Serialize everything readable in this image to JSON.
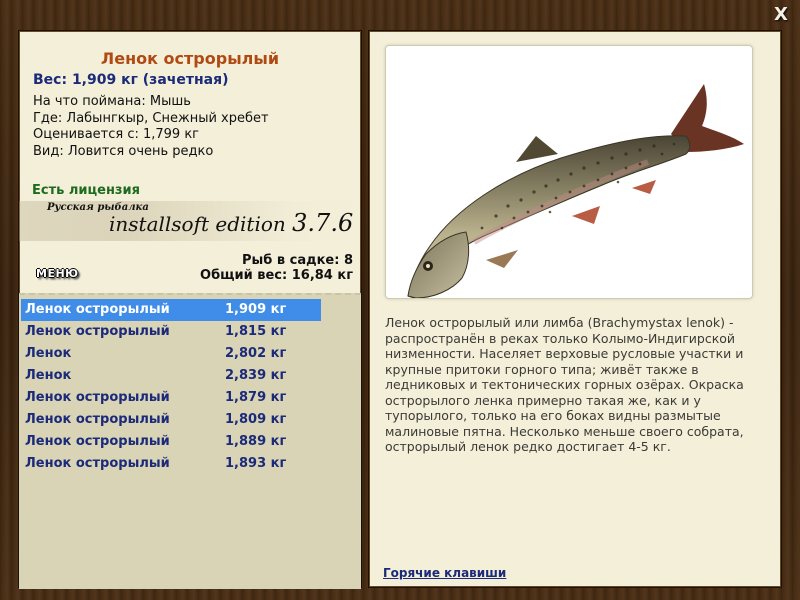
{
  "window": {
    "close_label": "X"
  },
  "fish": {
    "title": "Ленок острорылый",
    "weight_line": "Вес: 1,909 кг (зачетная)",
    "details": [
      "На что поймана: Мышь",
      "Где: Лабынгкыр, Снежный хребет",
      "Оценивается с: 1,799 кг",
      "Вид: Ловится очень редко"
    ],
    "license": "Есть лицензия",
    "image_name": "lenok-trout-photo"
  },
  "edition": {
    "small": "Русская рыбалка",
    "main": "installsoft edition",
    "version": "3.7.6"
  },
  "menu": {
    "label": "МЕНЮ"
  },
  "stats": {
    "count_line": "Рыб в садке: 8",
    "total_line": "Общий вес: 16,84 кг"
  },
  "catch_list": [
    {
      "name": "Ленок острорылый",
      "weight": "1,909 кг",
      "selected": true
    },
    {
      "name": "Ленок острорылый",
      "weight": "1,815 кг",
      "selected": false
    },
    {
      "name": "Ленок",
      "weight": "2,802 кг",
      "selected": false
    },
    {
      "name": "Ленок",
      "weight": "2,839 кг",
      "selected": false
    },
    {
      "name": "Ленок острорылый",
      "weight": "1,879 кг",
      "selected": false
    },
    {
      "name": "Ленок острорылый",
      "weight": "1,809 кг",
      "selected": false
    },
    {
      "name": "Ленок острорылый",
      "weight": "1,889 кг",
      "selected": false
    },
    {
      "name": "Ленок острорылый",
      "weight": "1,893 кг",
      "selected": false
    }
  ],
  "description": "Ленок острорылый или лимба (Brachymystax lenok) - распространён в реках только Колымо-Индигирской низменности. Населяет верховые русловые участки и крупные притоки горного типа; живёт также в ледниковых и тектонических горных озёрах. Окраска острорылого ленка примерно такая же, как и у тупорылого, только на его боках видны размытые малиновые пятна. Несколько меньше своего собрата, острорылый ленок редко достигает 4-5 кг.",
  "hotkeys": {
    "label": "Горячие клавиши"
  },
  "colors": {
    "title": "#b14a12",
    "weight": "#1c2a7a",
    "license": "#1e6a1e",
    "selection": "#3f8de8",
    "panel": "#f3efd9",
    "list_bg": "#d9d4b6"
  }
}
